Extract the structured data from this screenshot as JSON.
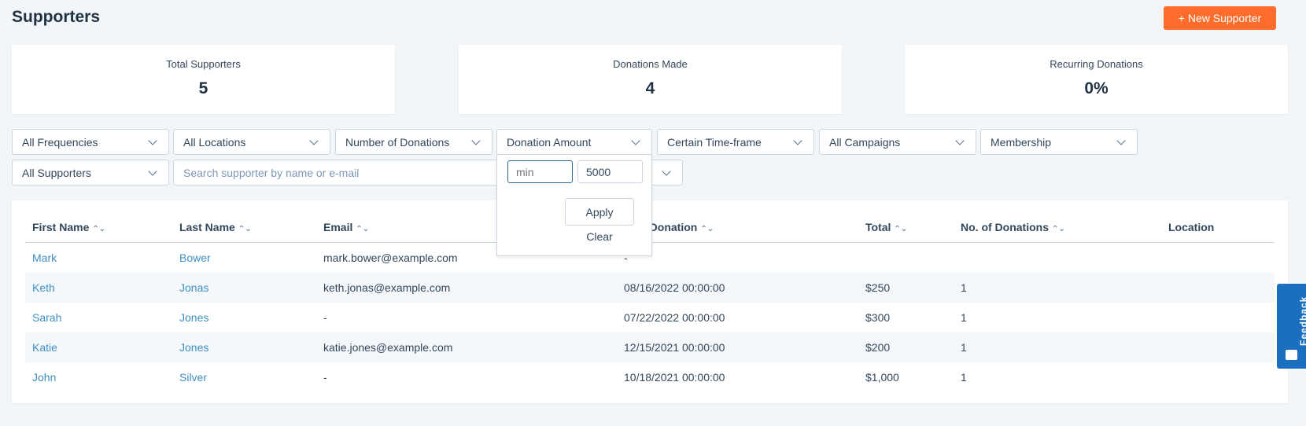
{
  "header": {
    "title": "Supporters",
    "new_button": "+ New Supporter"
  },
  "stats": [
    {
      "label": "Total Supporters",
      "value": "5"
    },
    {
      "label": "Donations Made",
      "value": "4"
    },
    {
      "label": "Recurring Donations",
      "value": "0%"
    }
  ],
  "filters": {
    "row1": [
      "All Frequencies",
      "All Locations",
      "Number of Donations",
      "Donation Amount",
      "Certain Time-frame",
      "All Campaigns",
      "Membership"
    ],
    "supporters": "All Supporters",
    "search_placeholder": "Search supporter by name or e-mail"
  },
  "amount_panel": {
    "min_placeholder": "min",
    "max_value": "5000",
    "apply": "Apply",
    "clear": "Clear"
  },
  "table": {
    "columns": [
      "First Name",
      "Last Name",
      "Email",
      "Last Donation",
      "Total",
      "No. of Donations",
      "Location"
    ],
    "rows": [
      [
        "Mark",
        "Bower",
        "mark.bower@example.com",
        "-",
        "",
        "",
        ""
      ],
      [
        "Keth",
        "Jonas",
        "keth.jonas@example.com",
        "08/16/2022 00:00:00",
        "$250",
        "1",
        ""
      ],
      [
        "Sarah",
        "Jones",
        "-",
        "07/22/2022 00:00:00",
        "$300",
        "1",
        ""
      ],
      [
        "Katie",
        "Jones",
        "katie.jones@example.com",
        "12/15/2021 00:00:00",
        "$200",
        "1",
        ""
      ],
      [
        "John",
        "Silver",
        "-",
        "10/18/2021 00:00:00",
        "$1,000",
        "1",
        ""
      ]
    ]
  },
  "feedback": {
    "label": "Feedback"
  },
  "colors": {
    "accent": "#ff6d2d",
    "link": "#3f8fc2",
    "feedback": "#1a6fc1"
  }
}
